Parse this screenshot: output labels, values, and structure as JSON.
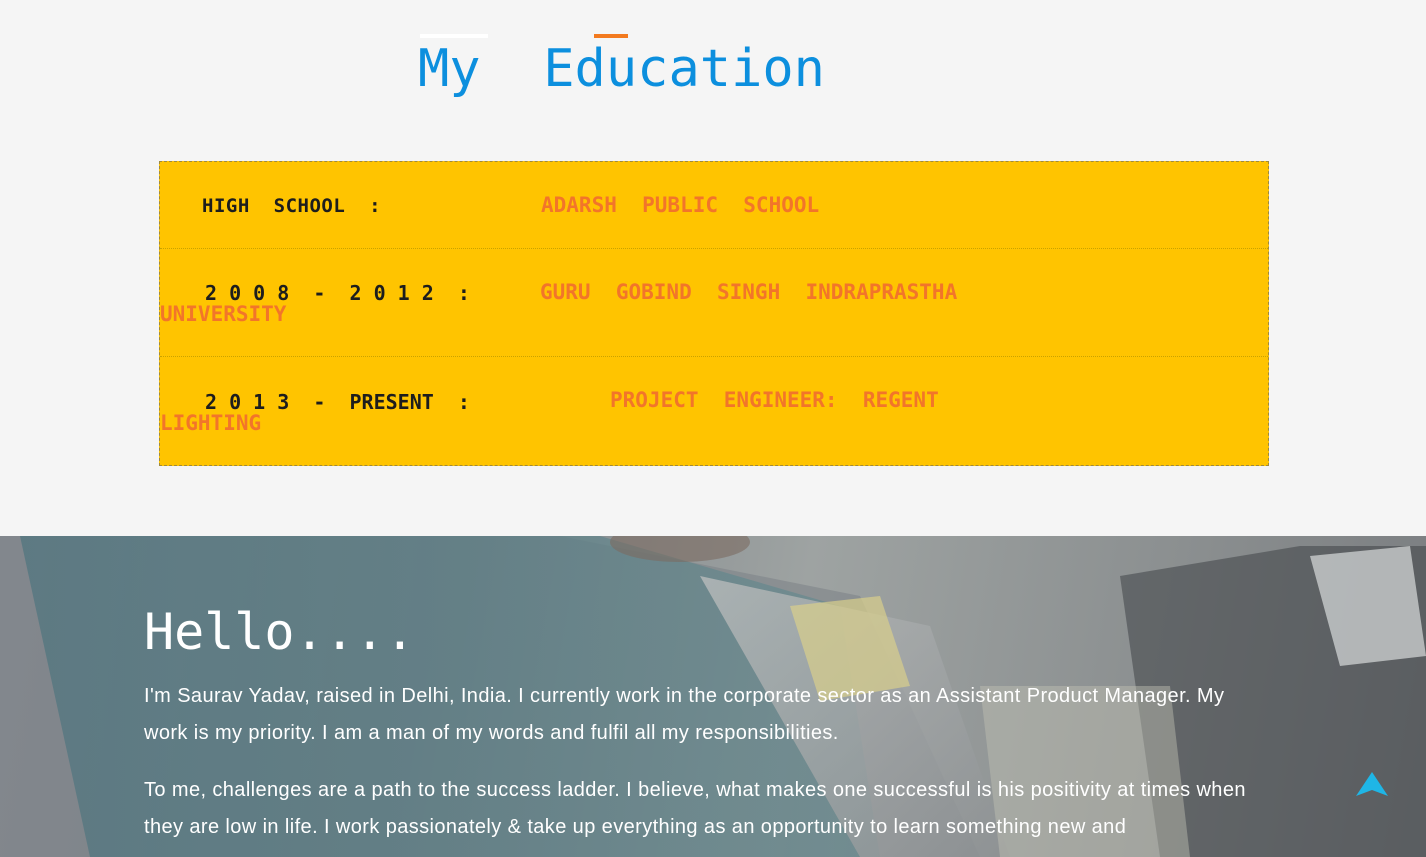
{
  "education": {
    "title": "My  Education",
    "rows": [
      {
        "label": "HIGH  SCHOOL  :",
        "value": "ADARSH  PUBLIC  SCHOOL"
      },
      {
        "label": "2 0 0 8  -  2 0 1 2  :",
        "value": "GURU  GOBIND  SINGH  INDRAPRASTHA",
        "value_cont": "UNIVERSITY"
      },
      {
        "label": "2 0 1 3  -  PRESENT  :",
        "value": "PROJECT  ENGINEER:  REGENT",
        "value_cont": "LIGHTING"
      }
    ]
  },
  "hello": {
    "heading": "Hello....",
    "paragraph1": "I'm Saurav Yadav, raised in Delhi, India. I currently work in the corporate sector as an Assistant Product Manager. My work is my priority. I am a man of my words and fulfil all my responsibilities.",
    "paragraph2": "To me, challenges are a path to the success ladder. I believe, what makes one successful is his positivity at times when they are low in life. I work passionately & take up everything as an opportunity to learn something new and"
  },
  "scroll_top": {
    "icon": "arrow-up-icon",
    "color": "#1fb6e6"
  },
  "colors": {
    "title_blue": "#0c8fde",
    "box_yellow": "#ffc400",
    "value_orange": "#f2752a",
    "accent_orange": "#f37a1f"
  }
}
